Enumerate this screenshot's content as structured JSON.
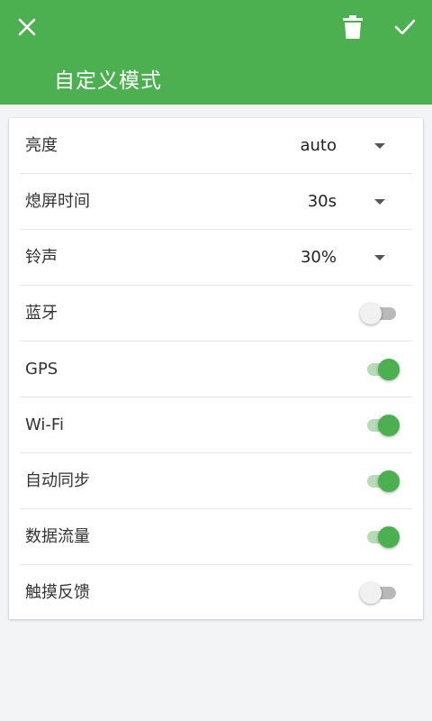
{
  "colors": {
    "primary": "#4caf50",
    "background": "#f3f4f6"
  },
  "toolbar": {
    "close_icon": "close-icon",
    "delete_icon": "trash-icon",
    "confirm_icon": "check-icon",
    "title": "自定义模式"
  },
  "settings": [
    {
      "label": "亮度",
      "type": "spinner",
      "value": "auto"
    },
    {
      "label": "熄屏时间",
      "type": "spinner",
      "value": "30s"
    },
    {
      "label": "铃声",
      "type": "spinner",
      "value": "30%"
    },
    {
      "label": "蓝牙",
      "type": "switch",
      "on": false
    },
    {
      "label": "GPS",
      "type": "switch",
      "on": true
    },
    {
      "label": "Wi-Fi",
      "type": "switch",
      "on": true
    },
    {
      "label": "自动同步",
      "type": "switch",
      "on": true
    },
    {
      "label": "数据流量",
      "type": "switch",
      "on": true
    },
    {
      "label": "触摸反馈",
      "type": "switch",
      "on": false
    }
  ]
}
